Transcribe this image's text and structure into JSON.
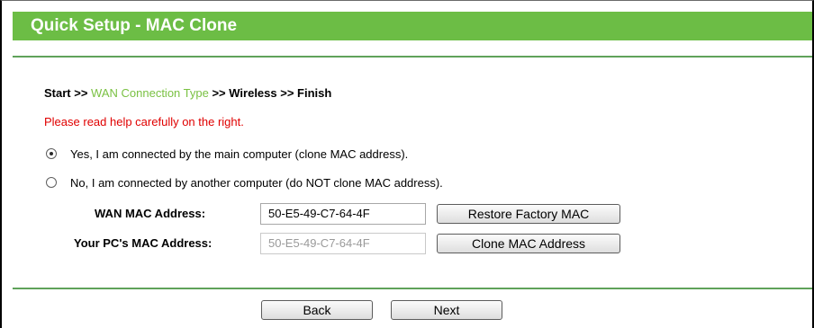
{
  "header": {
    "title": "Quick Setup - MAC Clone"
  },
  "breadcrumb": {
    "start": "Start",
    "sep1": " >> ",
    "current": "WAN Connection Type",
    "sep2": " >> ",
    "wireless": "Wireless",
    "sep3": " >> ",
    "finish": "Finish"
  },
  "warning": "Please read help carefully on the right.",
  "options": [
    {
      "label": "Yes, I am connected by the main computer (clone MAC address).",
      "checked": true
    },
    {
      "label": "No, I am connected by another computer (do NOT clone MAC address).",
      "checked": false
    }
  ],
  "wan_mac": {
    "label": "WAN MAC Address:",
    "value": "50-E5-49-C7-64-4F",
    "button": "Restore Factory MAC"
  },
  "pc_mac": {
    "label": "Your PC's MAC Address:",
    "value": "50-E5-49-C7-64-4F",
    "button": "Clone MAC Address"
  },
  "footer": {
    "back": "Back",
    "next": "Next"
  },
  "colors": {
    "title_bar": "#6cbd45",
    "separator": "#5fa25a",
    "link_green": "#7ac143",
    "warning_red": "#e00000"
  }
}
